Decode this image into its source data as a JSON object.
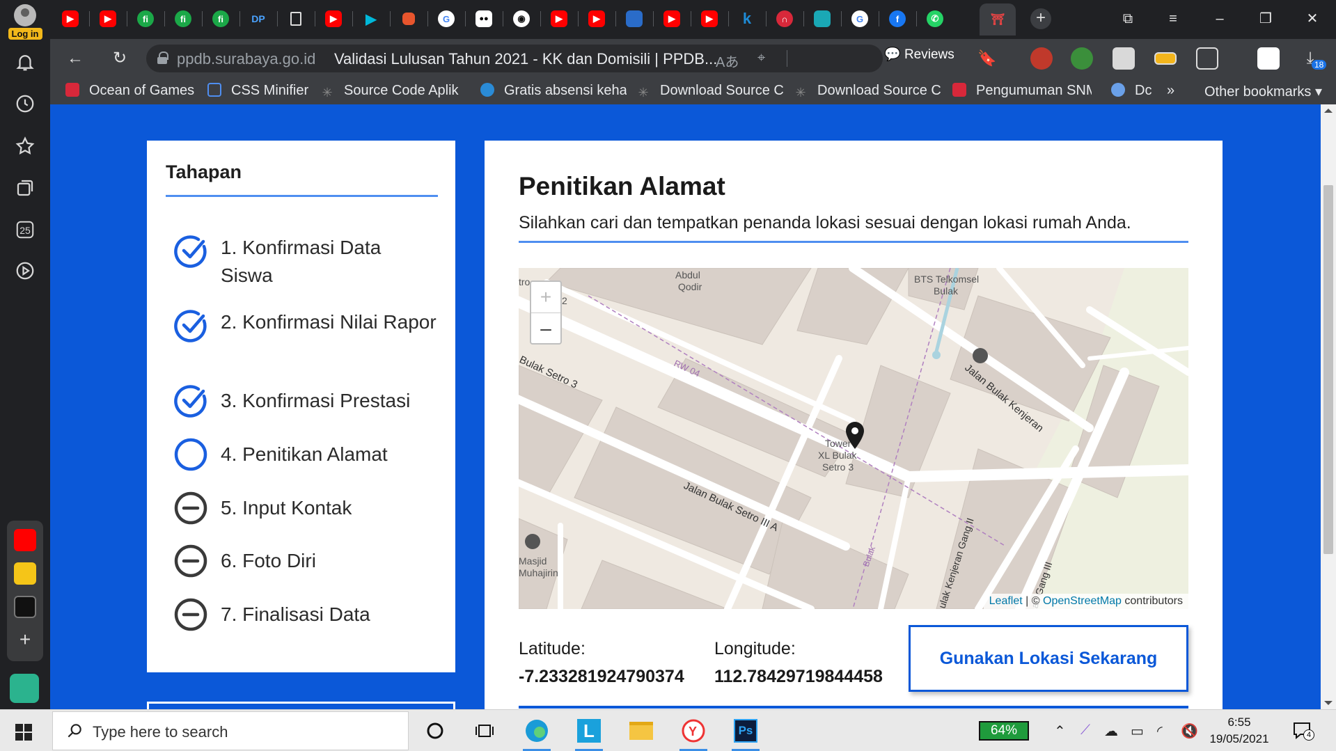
{
  "sidebar": {
    "login_label": "Log in",
    "calendar_day": "25"
  },
  "tabs": {
    "colors": {
      "youtube": "#ff0000",
      "green": "#1ba848"
    }
  },
  "omnibox": {
    "domain": "ppdb.surabaya.go.id",
    "title": "Validasi Lulusan Tahun 2021 - KK dan Domisili | PPDB...",
    "reviews_label": "Reviews",
    "badge_count": "18"
  },
  "bookmarks": [
    {
      "label": "Ocean of Games",
      "icon": "ocean-of-games-icon"
    },
    {
      "label": "CSS Minifier",
      "icon": "css-minifier-icon"
    },
    {
      "label": "Source Code Aplik",
      "icon": "source-code-icon"
    },
    {
      "label": "Gratis absensi keha",
      "icon": "absensi-icon"
    },
    {
      "label": "Download Source C",
      "icon": "download-source-icon"
    },
    {
      "label": "Download Source C",
      "icon": "download-source-icon"
    },
    {
      "label": "Pengumuman SNM",
      "icon": "pengumuman-icon"
    },
    {
      "label": "Dc",
      "icon": "dc-icon"
    }
  ],
  "bookmarks_more": "»",
  "other_bookmarks": "Other bookmarks",
  "steps": {
    "title": "Tahapan",
    "items": [
      {
        "label": "1. Konfirmasi Data Siswa",
        "status": "done"
      },
      {
        "label": "2. Konfirmasi Nilai Rapor",
        "status": "done"
      },
      {
        "label": "3. Konfirmasi Prestasi",
        "status": "done"
      },
      {
        "label": "4. Penitikan Alamat",
        "status": "current"
      },
      {
        "label": "5. Input Kontak",
        "status": "pending"
      },
      {
        "label": "6. Foto Diri",
        "status": "pending"
      },
      {
        "label": "7. Finalisasi Data",
        "status": "pending"
      }
    ]
  },
  "main": {
    "title": "Penitikan Alamat",
    "subtitle": "Silahkan cari dan tempatkan penanda lokasi sesuai dengan lokasi rumah Anda.",
    "map": {
      "zoom_in": "+",
      "zoom_out": "–",
      "labels": {
        "masjid_abdul_qodir": "Masjid Abdul Qodir",
        "abdul": "Abdul",
        "qodir": "Qodir",
        "bts_1": "BTS Telkomsel",
        "bts_2": "Bulak",
        "rw": "RW 04",
        "bulak_setro_3": "Bulak Setro 3",
        "jalan_bulak_kenjeran": "Jalan Bulak Kenjeran",
        "tower_1": "Tower",
        "tower_2": "XL Bulak",
        "tower_3": "Setro 3",
        "jalan_bulak_setro_3a": "Jalan Bulak Setro III A",
        "masjid_1": "Masjid",
        "masjid_2": "Muhajirin",
        "bulak": "Bulak",
        "kenjeran_gang_2": "ulak Kenjeran Gang II",
        "gang_3": "an Gang III",
        "tro": "tro",
        "two": "2"
      },
      "attribution_leaflet": "Leaflet",
      "attribution_sep": "| ©",
      "attribution_osm": "OpenStreetMap",
      "attribution_tail": "contributors"
    },
    "latitude_label": "Latitude:",
    "latitude_value": "-7.233281924790374",
    "longitude_label": "Longitude:",
    "longitude_value": "112.78429719844458",
    "use_location_button": "Gunakan Lokasi Sekarang"
  },
  "taskbar": {
    "search_placeholder": "Type here to search",
    "battery": "64%",
    "time": "6:55",
    "date": "19/05/2021",
    "notification_count": "4"
  },
  "colors": {
    "page_background": "#0b58d8",
    "accent_line": "#4f8ef0",
    "step_done": "#1a5fe0",
    "step_pending": "#3a3a3a"
  }
}
